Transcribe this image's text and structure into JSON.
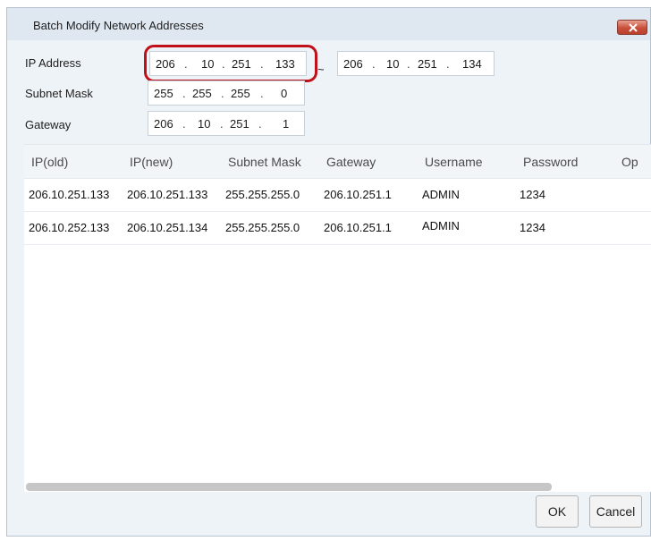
{
  "window": {
    "title": "Batch Modify Network Addresses",
    "close_icon": "close-icon"
  },
  "form": {
    "ip_label": "IP Address",
    "ip_start": [
      "206",
      "10",
      "251",
      "133"
    ],
    "range_sep": "~",
    "ip_end": [
      "206",
      "10",
      "251",
      "134"
    ],
    "subnet_label": "Subnet Mask",
    "subnet": [
      "255",
      "255",
      "255",
      "0"
    ],
    "gateway_label": "Gateway",
    "gateway": [
      "206",
      "10",
      "251",
      "1"
    ],
    "dot": "."
  },
  "table": {
    "columns": [
      "IP(old)",
      "IP(new)",
      "Subnet Mask",
      "Gateway",
      "Username",
      "Password",
      "Op"
    ],
    "rows": [
      [
        "206.10.251.133",
        "206.10.251.133",
        "255.255.255.0",
        "206.10.251.1",
        "ADMIN",
        "1234"
      ],
      [
        "206.10.252.133",
        "206.10.251.134",
        "255.255.255.0",
        "206.10.251.1",
        "ADMIN",
        "1234"
      ]
    ]
  },
  "buttons": {
    "ok": "OK",
    "cancel": "Cancel"
  },
  "colors": {
    "highlight": "#c0111a",
    "dialog_bg": "#eef3f8",
    "close_button": "#c9503a"
  }
}
